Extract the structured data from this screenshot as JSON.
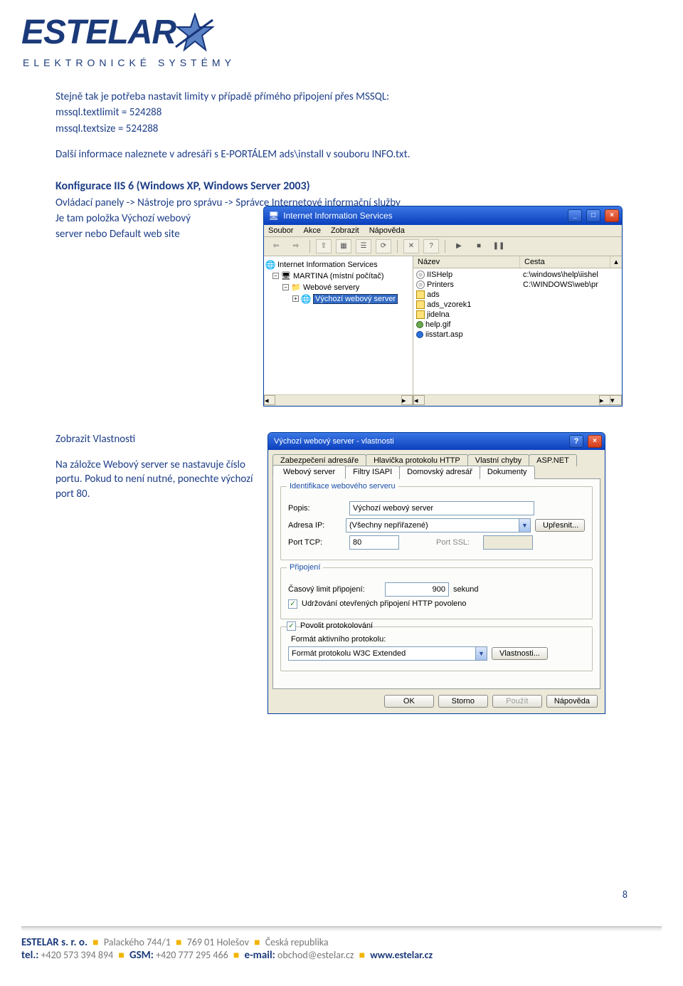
{
  "header": {
    "logo_text": "ESTELAR",
    "logo_sub": "ELEKTRONICKÉ SYSTÉMY"
  },
  "body": {
    "para1": "Stejně tak je potřeba nastavit limity v případě přímého připojení přes MSSQL:",
    "line1": "mssql.textlimit = 524288",
    "line2": "mssql.textsize = 524288",
    "para2": "Další informace naleznete v adresáři s E-PORTÁLEM ads\\install v souboru INFO.txt.",
    "heading": "Konfigurace IIS 6 (Windows XP, Windows Server 2003)",
    "para3": "Ovládací panely  -> Nástroje pro správu -> Správce Internetové informační služby",
    "para4a": "Je tam položka Výchozí webový",
    "para4b": "server nebo Default web site",
    "para5": "Zobrazit Vlastnosti",
    "para6": "Na záložce Webový server se nastavuje číslo portu. Pokud to není nutné, ponechte výchozí port 80."
  },
  "mmc": {
    "title": "Internet Information Services",
    "menu": {
      "file": "Soubor",
      "action": "Akce",
      "view": "Zobrazit",
      "help": "Nápověda"
    },
    "tree": {
      "root": "Internet Information Services",
      "pc": "MARTINA (místní počítač)",
      "ws": "Webové servery",
      "default": "Výchozí webový server"
    },
    "cols": {
      "name": "Název",
      "path": "Cesta"
    },
    "rows": [
      {
        "t": "gear",
        "name": "IISHelp",
        "path": "c:\\windows\\help\\iishel"
      },
      {
        "t": "gear",
        "name": "Printers",
        "path": "C:\\WINDOWS\\web\\pr"
      },
      {
        "t": "fld",
        "name": "ads",
        "path": ""
      },
      {
        "t": "fld",
        "name": "ads_vzorek1",
        "path": ""
      },
      {
        "t": "fld",
        "name": "jidelna",
        "path": ""
      },
      {
        "t": "gif",
        "name": "help.gif",
        "path": ""
      },
      {
        "t": "asp",
        "name": "iisstart.asp",
        "path": ""
      }
    ]
  },
  "dlg": {
    "title": "Výchozí webový server - vlastnosti",
    "tabs_back": [
      "Zabezpečení adresáře",
      "Hlavička protokolu HTTP",
      "Vlastní chyby",
      "ASP.NET"
    ],
    "tabs_front": [
      "Webový server",
      "Filtry ISAPI",
      "Domovský adresář",
      "Dokumenty"
    ],
    "grp1": {
      "legend": "Identifikace webového serveru",
      "l_popis": "Popis:",
      "v_popis": "Výchozí webový server",
      "l_ip": "Adresa IP:",
      "v_ip": "(Všechny nepřiřazené)",
      "l_upresnit": "Upřesnit...",
      "l_tcp": "Port TCP:",
      "v_tcp": "80",
      "l_ssl": "Port SSL:",
      "v_ssl": ""
    },
    "grp2": {
      "legend": "Připojení",
      "l_timeout": "Časový limit připojení:",
      "v_timeout": "900",
      "unit": "sekund",
      "keepalive": "Udržování otevřených připojení HTTP povoleno"
    },
    "grp3": {
      "enable": "Povolit protokolování",
      "l_fmt": "Formát aktivního protokolu:",
      "v_fmt": "Formát protokolu W3C Extended",
      "l_props": "Vlastnosti..."
    },
    "buttons": {
      "ok": "OK",
      "cancel": "Storno",
      "apply": "Použít",
      "help": "Nápověda"
    }
  },
  "page_number": "8",
  "footer": {
    "company": "ESTELAR s. r. o.",
    "addr1": "Palackého 744/1",
    "addr2": "769 01 Holešov",
    "addr3": "Česká republika",
    "tel_label": "tel.:",
    "tel": "+420 573 394 894",
    "gsm_label": "GSM:",
    "gsm": "+420 777 295 466",
    "email_label": "e-mail:",
    "email": "obchod@estelar.cz",
    "web": "www.estelar.cz"
  }
}
